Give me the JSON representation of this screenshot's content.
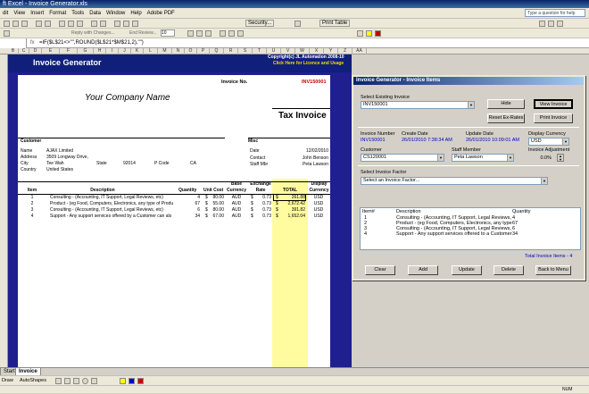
{
  "window": {
    "title": "ft Excel - Invoice Generator.xls"
  },
  "menu": [
    "dit",
    "View",
    "Insert",
    "Format",
    "Tools",
    "Data",
    "Window",
    "Help",
    "Adobe PDF"
  ],
  "help_placeholder": "Type a question for help",
  "toolbar": {
    "security": "Security...",
    "reply": "Reply with Changes...",
    "end_review": "End Review...",
    "font_size": "10",
    "print_label": "Print Table"
  },
  "formula_bar": {
    "formula": "=IF($L$21<>\"\",ROUND($L$21*$M$21,2),\"\")"
  },
  "columns": [
    "B",
    "C",
    "D",
    "E",
    "F",
    "G",
    "H",
    "I",
    "J",
    "K",
    "L",
    "M",
    "N",
    "O",
    "P",
    "Q",
    "R",
    "S",
    "T",
    "U",
    "V",
    "W",
    "X",
    "Y",
    "Z",
    "AA"
  ],
  "sheet": {
    "app_title": "Invoice Generator",
    "copyright": "Copyright(c) JL Automation 2008-10",
    "licence_link": "Click Here for Licence and Usage",
    "invoice_no_label": "Invoice No.",
    "invoice_no": "INV150001",
    "company": "Your Company Name",
    "doc_title": "Tax Invoice",
    "customer_header": "Customer",
    "customer": {
      "name_label": "Name",
      "name": "AJAX Limited",
      "address_label": "Address",
      "address": "3509 Longway Drive,",
      "city_label": "City",
      "city": "Tee Wah",
      "state_label": "State",
      "state": "92014",
      "pcode_label": "P Code",
      "pcode": "CA",
      "country_label": "Country",
      "country": "United States"
    },
    "misc_header": "Misc",
    "misc": {
      "date_label": "Date",
      "date": "12/02/2010",
      "contact_label": "Contact",
      "contact": "John Benson",
      "staff_label": "Staff Mbr",
      "staff": "Peta Lawson"
    },
    "table_headers": {
      "item": "Item",
      "description": "Description",
      "quantity": "Quantity",
      "unit_cost": "Unit Cost",
      "base_currency": "Base Currency",
      "exchange_rate": "Exchange Rate",
      "total": "TOTAL",
      "display_currency": "Display Currency"
    },
    "rows": [
      {
        "item": "1",
        "description": "Consulting - (Accounting, IT Support, Legal Reviews, etc)",
        "qty": "4",
        "cur1": "$",
        "unit": "80.00",
        "base": "AUD",
        "cur2": "$",
        "rate": "0.73",
        "cur3": "$",
        "total": "261.88",
        "disp": "USD"
      },
      {
        "item": "2",
        "description": "Product - (eg Food, Computers, Electronics, any type of Produ",
        "qty": "67",
        "cur1": "$",
        "unit": "55.00",
        "base": "AUD",
        "cur2": "$",
        "rate": "0.73",
        "cur3": "$",
        "total": "2,672.42",
        "disp": "USD"
      },
      {
        "item": "3",
        "description": "Consulting - (Accounting, IT Support, Legal Reviews, etc)",
        "qty": "6",
        "cur1": "$",
        "unit": "80.00",
        "base": "AUD",
        "cur2": "$",
        "rate": "0.73",
        "cur3": "$",
        "total": "391.82",
        "disp": "USD"
      },
      {
        "item": "4",
        "description": "Support - Any support services offered by a Customer can als",
        "qty": "34",
        "cur1": "$",
        "unit": "67.00",
        "base": "AUD",
        "cur2": "$",
        "rate": "0.73",
        "cur3": "$",
        "total": "1,652.04",
        "disp": "USD"
      }
    ]
  },
  "dialog": {
    "title": "Invoice Generator - Invoice Items",
    "select_existing_label": "Select Existing Invoice",
    "select_existing_value": "INV150001",
    "hide": "Hide",
    "view_invoice": "View Invoice",
    "reset_rates": "Reset Ex-Rates",
    "print_invoice": "Print Invoice",
    "invoice_number_label": "Invoice Number",
    "invoice_number": "INV150001",
    "create_date_label": "Create Date",
    "create_date": "26/01/2010 7:38:34 AM",
    "update_date_label": "Update Date",
    "update_date": "26/01/2010 10:09:01 AM",
    "display_currency_label": "Display Currency",
    "display_currency": "USD",
    "customer_label": "Customer",
    "customer": "CS120001",
    "staff_label": "Staff Member",
    "staff": "Peta Lawson",
    "adjustment_label": "Invoice Adjustment",
    "adjustment": "0.0%",
    "factor_label": "Select Invoice Factor",
    "factor_placeholder": "Select an Invoice Factor...",
    "list_headers": {
      "item": "Item#",
      "description": "Description",
      "quantity": "Quantity"
    },
    "list_items": [
      {
        "item": "1",
        "description": "Consulting - (Accounting, IT Support, Legal Reviews,",
        "qty": "4"
      },
      {
        "item": "2",
        "description": "Product - (eg Food, Computers, Electronics, any type",
        "qty": "67"
      },
      {
        "item": "3",
        "description": "Consulting - (Accounting, IT Support, Legal Reviews,",
        "qty": "6"
      },
      {
        "item": "4",
        "description": "Support - Any support services offered to a Customer",
        "qty": "34"
      }
    ],
    "total_items": "Total Invoice Items - 4",
    "buttons": [
      "Clear",
      "Add",
      "Update",
      "Delete",
      "Back to Menu"
    ]
  },
  "sheet_tabs": [
    "Start",
    "Invoice"
  ],
  "drawing": {
    "draw": "Draw",
    "autoshapes": "AutoShapes"
  },
  "status": {
    "num": "NUM"
  },
  "colors": {
    "sheet_bg": "#1f1f8f",
    "accent_red": "#cc0000",
    "highlight": "#fffb9e",
    "title_blue": "#0a246a"
  }
}
